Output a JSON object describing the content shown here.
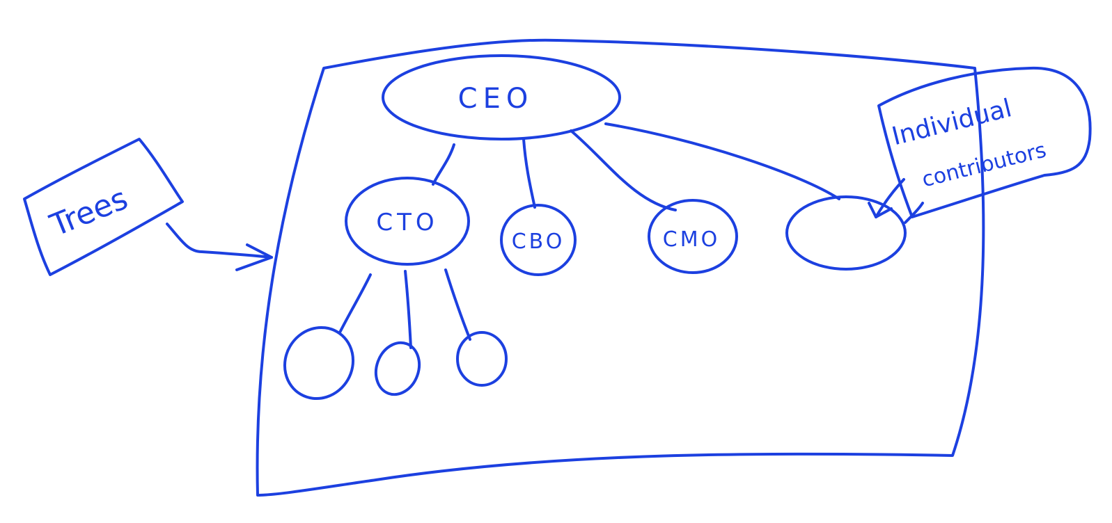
{
  "diagram": {
    "ink_color": "#1c40e0",
    "background": "#ffffff",
    "nodes": {
      "ceo": "CEO",
      "cto": "CTO",
      "cbo": "CBO",
      "cmo": "CMO"
    },
    "notes": {
      "trees": "Trees",
      "individual_contributors_line1": "Individual",
      "individual_contributors_line2": "contributors"
    }
  }
}
